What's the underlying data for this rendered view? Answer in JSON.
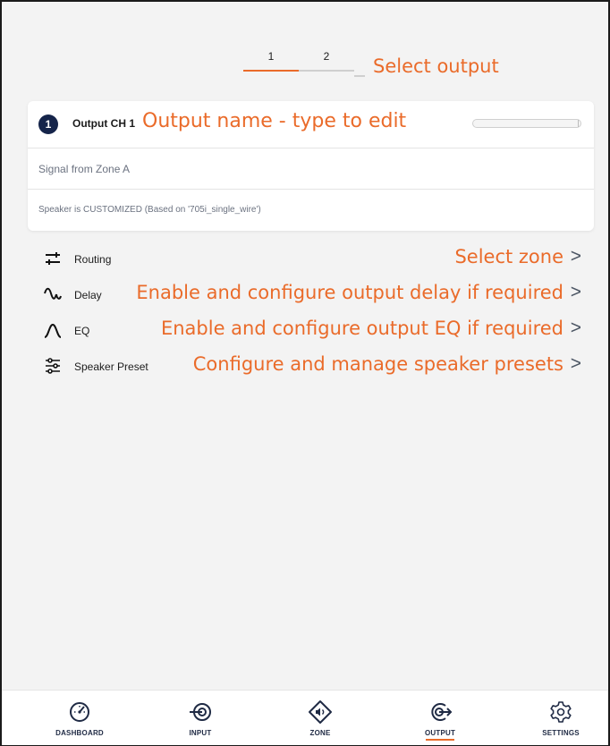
{
  "tabs": [
    {
      "label": "1",
      "active": true
    },
    {
      "label": "2",
      "active": false
    }
  ],
  "annotations": {
    "select_output": "Select output",
    "output_name": "Output name - type to edit"
  },
  "channel": {
    "number": "1",
    "name": "Output CH 1",
    "signal": "Signal from Zone A",
    "speaker": "Speaker is CUSTOMIZED (Based on '705i_single_wire')"
  },
  "menu": [
    {
      "label": "Routing",
      "annotation": "Select zone",
      "icon": "routing-icon"
    },
    {
      "label": "Delay",
      "annotation": "Enable and configure output delay if required",
      "icon": "delay-icon"
    },
    {
      "label": "EQ",
      "annotation": "Enable and configure output EQ if required",
      "icon": "eq-icon"
    },
    {
      "label": "Speaker Preset",
      "annotation": "Configure and manage speaker presets",
      "icon": "speaker-preset-icon"
    }
  ],
  "chevron": ">",
  "nav": [
    {
      "label": "DASHBOARD",
      "icon": "dashboard-icon",
      "active": false
    },
    {
      "label": "INPUT",
      "icon": "input-icon",
      "active": false
    },
    {
      "label": "ZONE",
      "icon": "zone-icon",
      "active": false
    },
    {
      "label": "OUTPUT",
      "icon": "output-icon",
      "active": true
    },
    {
      "label": "SETTINGS",
      "icon": "settings-icon",
      "active": false
    }
  ],
  "colors": {
    "accent": "#ea6b2a",
    "navy": "#15244a",
    "background": "#f3f3f3"
  }
}
